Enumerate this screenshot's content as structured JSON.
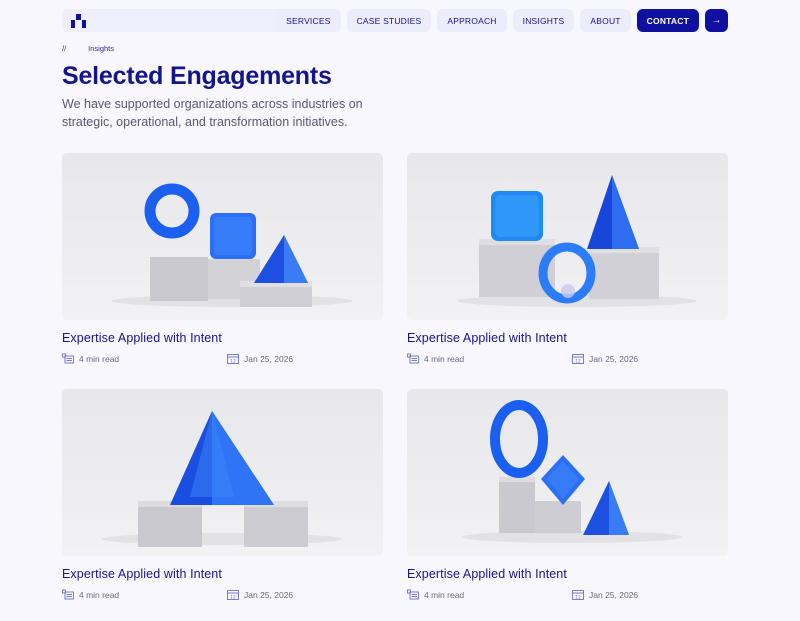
{
  "header": {
    "nav": [
      "SERVICES",
      "CASE STUDIES",
      "APPROACH",
      "INSIGHTS",
      "ABOUT"
    ],
    "contact_label": "CONTACT",
    "arrow_label": "→"
  },
  "breadcrumb": {
    "separator": "//",
    "current": "Insights"
  },
  "page": {
    "title": "Selected Engagements",
    "subtitle": "We have supported organizations across industries on strategic, operational, and transformation initiatives."
  },
  "cards": [
    {
      "title": "Expertise Applied with Intent",
      "read_time": "4 min read",
      "date": "Jan 25, 2026"
    },
    {
      "title": "Expertise Applied with Intent",
      "read_time": "4 min read",
      "date": "Jan 25, 2026"
    },
    {
      "title": "Expertise Applied with Intent",
      "read_time": "4 min read",
      "date": "Jan 25, 2026"
    },
    {
      "title": "Expertise Applied with Intent",
      "read_time": "4 min read",
      "date": "Jan 25, 2026"
    }
  ],
  "colors": {
    "brand": "#1010a0",
    "accent_blue": "#1a5ff0",
    "background": "#f7f7fd"
  }
}
